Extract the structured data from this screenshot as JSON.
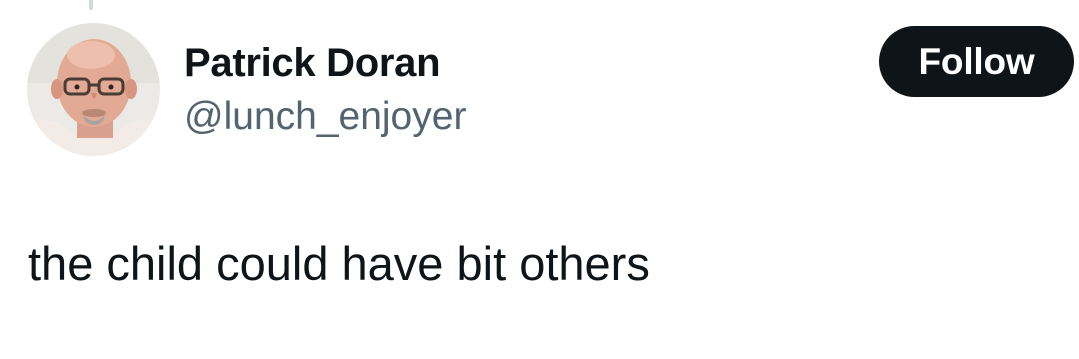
{
  "tweet": {
    "author": {
      "display_name": "Patrick Doran",
      "handle": "@lunch_enjoyer",
      "avatar_icon": "profile-photo"
    },
    "follow_label": "Follow",
    "text": "the child could have bit others"
  },
  "colors": {
    "text_primary": "#0f1419",
    "text_secondary": "#536471",
    "button_bg": "#0f1419",
    "button_text": "#ffffff",
    "thread_line": "#cfd9de"
  }
}
